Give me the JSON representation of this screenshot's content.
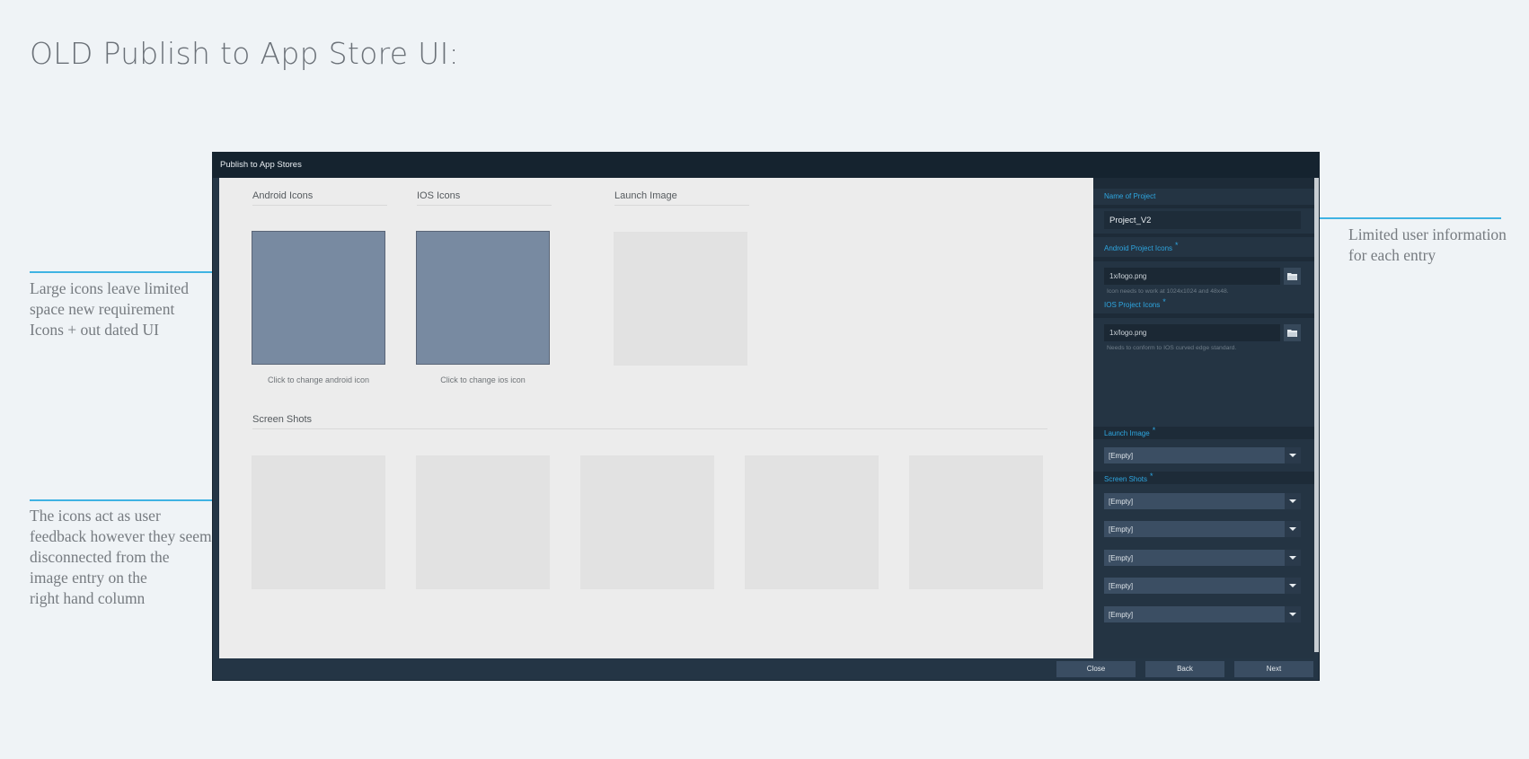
{
  "page": {
    "title": "OLD Publish to App Store UI:"
  },
  "notes": {
    "left_top": [
      "Large icons leave limited",
      "space new requirement",
      "Icons + out dated UI"
    ],
    "left_bottom": [
      "The icons act as user",
      "feedback however they seem",
      "disconnected from the",
      "image entry on the",
      "right hand column"
    ],
    "right": [
      "Limited user information",
      "for each entry"
    ]
  },
  "window": {
    "title": "Publish to App Stores",
    "canvas": {
      "android_icons_label": "Android Icons",
      "ios_icons_label": "IOS Icons",
      "launch_image_label": "Launch Image",
      "android_caption": "Click to change android icon",
      "ios_caption": "Click to change ios icon",
      "screen_shots_label": "Screen Shots"
    },
    "panel": {
      "name_label": "Name of Project",
      "name_value": "Project_V2",
      "android_label": "Android Project Icons",
      "android_value": "1x/logo.png",
      "android_hint": "Icon needs to work at 1024x1024 and 48x48.",
      "ios_label": "IOS Project Icons",
      "ios_value": "1x/logo.png",
      "ios_hint": "Needs to conform to IOS curved edge standard.",
      "launch_label": "Launch Image",
      "launch_value": "[Empty]",
      "screens_label": "Screen Shots",
      "screens": [
        "[Empty]",
        "[Empty]",
        "[Empty]",
        "[Empty]",
        "[Empty]"
      ],
      "required_mark": "*"
    },
    "footer": {
      "close": "Close",
      "back": "Back",
      "next": "Next"
    }
  },
  "colors": {
    "accent_line": "#3fb3e3",
    "window_bg": "#243545",
    "icon_tile": "#788aa1"
  },
  "icons": [
    "folder-icon",
    "dropdown-arrow-icon"
  ]
}
